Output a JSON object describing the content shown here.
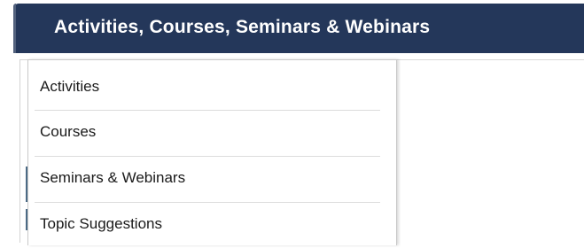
{
  "nav": {
    "title": "Activities, Courses, Seminars & Webinars"
  },
  "dropdown": {
    "items": [
      {
        "label": "Activities"
      },
      {
        "label": "Courses"
      },
      {
        "label": "Seminars & Webinars"
      },
      {
        "label": "Topic Suggestions"
      }
    ]
  },
  "colors": {
    "nav_background": "#24375a",
    "nav_text": "#ffffff",
    "menu_text": "#1a1a1a",
    "divider": "#dcdcdc"
  }
}
